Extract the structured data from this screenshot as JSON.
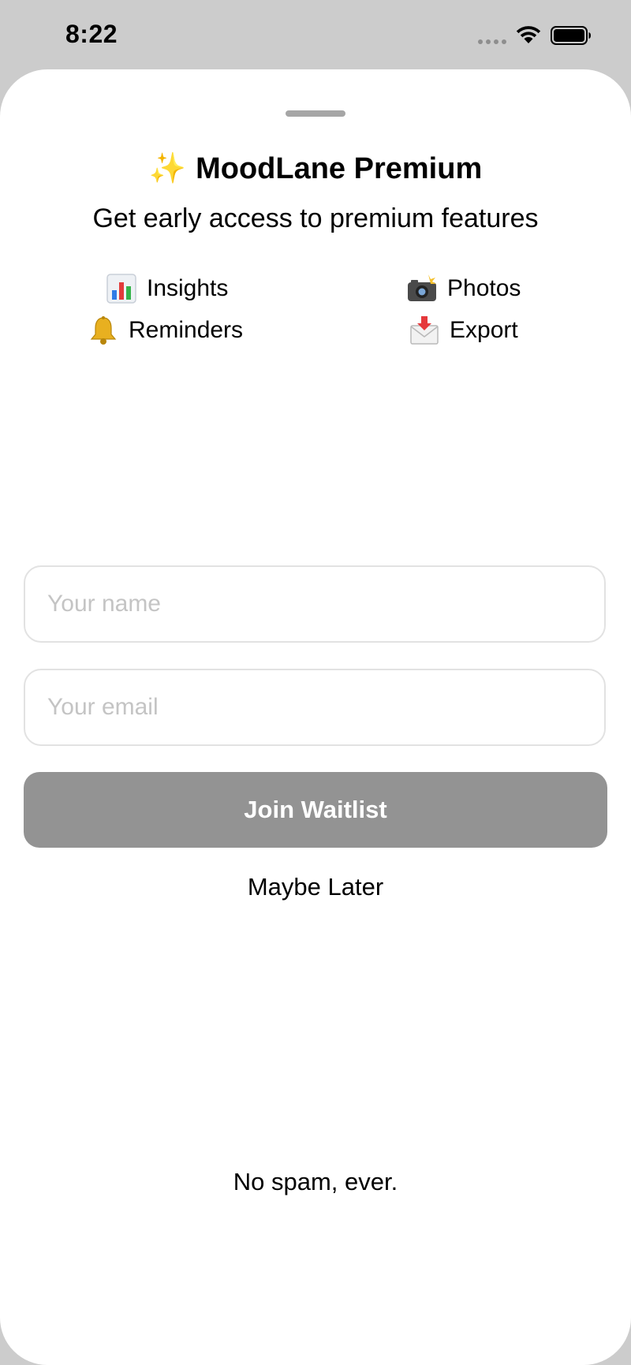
{
  "status_bar": {
    "time": "8:22",
    "signal_icon": "cellular-dots-icon",
    "wifi_icon": "wifi-icon",
    "battery_icon": "battery-full-icon"
  },
  "sheet": {
    "title_emoji": "✨",
    "title": "MoodLane Premium",
    "subtitle": "Get early access to premium features",
    "features": [
      {
        "emoji": "📊",
        "icon": "bar-chart-icon",
        "label": "Insights"
      },
      {
        "emoji": "📸",
        "icon": "camera-flash-icon",
        "label": "Photos"
      },
      {
        "emoji": "🔔",
        "icon": "bell-icon",
        "label": "Reminders"
      },
      {
        "emoji": "📩",
        "icon": "envelope-arrow-icon",
        "label": "Export"
      }
    ],
    "form": {
      "name_value": "",
      "name_placeholder": "Your name",
      "email_value": "",
      "email_placeholder": "Your email"
    },
    "join_label": "Join Waitlist",
    "maybe_later_label": "Maybe Later",
    "footer_note": "No spam, ever."
  },
  "colors": {
    "backdrop": "#cccccc",
    "sheet": "#ffffff",
    "button_disabled": "#939393",
    "placeholder": "#c4c4c4",
    "field_border": "#e2e2e2"
  }
}
